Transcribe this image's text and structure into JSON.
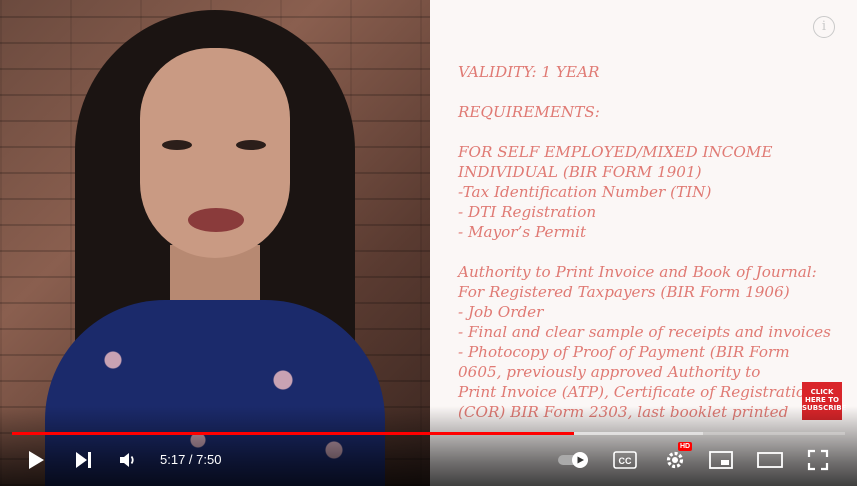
{
  "overlay_text": {
    "lines": [
      "VALIDITY: 1 YEAR",
      "",
      "REQUIREMENTS:",
      "",
      "FOR SELF EMPLOYED/MIXED INCOME",
      "INDIVIDUAL (BIR FORM 1901)",
      "-Tax Identification Number (TIN)",
      "- DTI Registration",
      "- Mayor’s Permit",
      "",
      "Authority to Print Invoice and Book of Journal:",
      "For Registered Taxpayers (BIR Form 1906)",
      "- Job Order",
      "- Final and clear sample of receipts and invoices",
      "- Photocopy of Proof of Payment (BIR Form",
      "0605, previously approved Authority to",
      "Print Invoice (ATP), Certificate of Registration",
      "(COR) BIR Form 2303, last booklet printed"
    ],
    "color": "#e07a74"
  },
  "info_icon": "i",
  "subscribe_button": {
    "label": "CLICK HERE TO SUBSCRIBE"
  },
  "player": {
    "current_time": "5:17",
    "duration": "7:50",
    "time_display": "5:17 / 7:50",
    "progress_fraction": 0.675,
    "buffer_fraction": 0.83,
    "hd_badge": "HD",
    "cc_label": "CC",
    "progress_color": "#ff0000"
  }
}
